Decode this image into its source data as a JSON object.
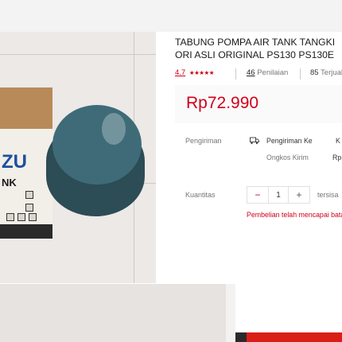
{
  "product": {
    "title_line1": "TABUNG POMPA AIR TANK TANGKI",
    "title_line2": "ORI ASLI ORIGINAL PS130 PS130E",
    "rating": "4.7",
    "rating_stars": "★★★★★",
    "reviews_count": "46",
    "reviews_label": "Penilaian",
    "sold_count": "85",
    "sold_label": "Terjual",
    "price": "Rp72.990"
  },
  "image": {
    "box_logo": "ZU",
    "box_text": "NK"
  },
  "shipping": {
    "label": "Pengiriman",
    "to_label": "Pengiriman Ke",
    "to_value": "K",
    "cost_label": "Ongkos Kirim",
    "cost_value": "Rp"
  },
  "quantity": {
    "label": "Kuantitas",
    "decrement": "−",
    "value": "1",
    "increment": "+",
    "stock_text": "tersisa",
    "limit_warning": "Pembelian telah mencapai batas"
  },
  "colors": {
    "accent": "#d0011b",
    "price_bg": "#fafafa"
  }
}
